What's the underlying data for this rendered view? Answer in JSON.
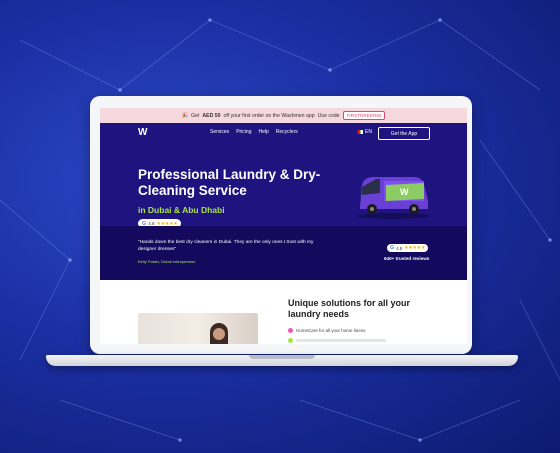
{
  "promo": {
    "icon": "party-icon",
    "text_before": "Get",
    "amount": "AED 50",
    "text_after": "off your first order on the Washmen app",
    "use_code": "Use code",
    "code": "FIRSTORDER50"
  },
  "nav": {
    "logo": "W",
    "links": [
      "Services",
      "Pricing",
      "Help",
      "Recyclers"
    ],
    "language": "EN",
    "cta": "Get the App"
  },
  "hero": {
    "title": "Professional Laundry & Dry-Cleaning Service",
    "subtitle": "in Dubai & Abu Dhabi",
    "rating": "4.8",
    "stars": "★★★★★",
    "google": "G"
  },
  "testimonial": {
    "quote": "\"Hands down the best dry cleaners in Dubai. They are the only ones I trust with my designer dresses\"",
    "author": "Kelly Foster, Dubai entrepreneur",
    "rating": "4.8",
    "stars": "★★★★★",
    "google": "G",
    "trusted": "640+ trusted reviews"
  },
  "section": {
    "title": "Unique solutions for all your laundry needs",
    "feature1": "HomeCare for all your home linens"
  },
  "colors": {
    "hero_bg": "#1f1380",
    "accent_green": "#a7e34b",
    "promo_bg": "#f6d8df"
  }
}
